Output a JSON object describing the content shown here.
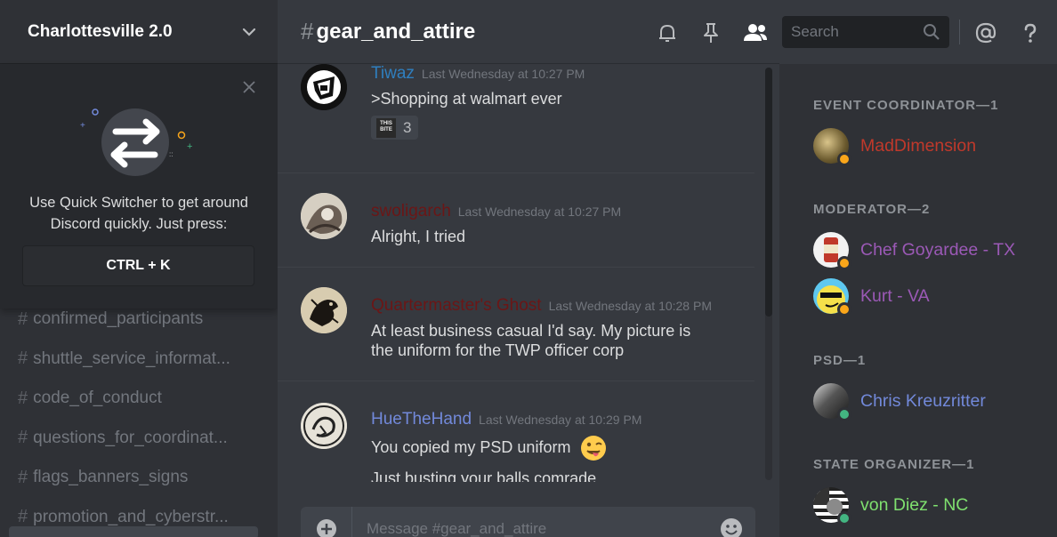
{
  "server": {
    "name": "Charlottesville 2.0"
  },
  "quick_switcher": {
    "line1": "Use Quick Switcher to get around",
    "line2": "Discord quickly. Just press:",
    "shortcut": "CTRL + K"
  },
  "channels": [
    {
      "name": "confirmed_participants"
    },
    {
      "name": "shuttle_service_informat..."
    },
    {
      "name": "code_of_conduct"
    },
    {
      "name": "questions_for_coordinat..."
    },
    {
      "name": "flags_banners_signs"
    },
    {
      "name": "promotion_and_cyberstr..."
    }
  ],
  "channel_header": {
    "hash": "#",
    "name": "gear_and_attire"
  },
  "search": {
    "placeholder": "Search"
  },
  "messages": [
    {
      "author": "Tiwaz",
      "author_color": "#2f7fbf",
      "timestamp": "Last Wednesday at 10:27 PM",
      "lines": [
        ">Shopping at walmart ever"
      ],
      "reaction": {
        "emoji_text": "THIS BITE",
        "count": "3"
      }
    },
    {
      "author": "swoligarch",
      "author_color": "#6b1616",
      "timestamp": "Last Wednesday at 10:27 PM",
      "lines": [
        "Alright, I tried"
      ]
    },
    {
      "author": "Quartermaster's Ghost",
      "author_color": "#6b1616",
      "timestamp": "Last Wednesday at 10:28 PM",
      "lines": [
        "At least business casual I'd say. My picture is",
        "the uniform for the TWP officer corp"
      ]
    },
    {
      "author": "HueTheHand",
      "author_color": "#7289da",
      "timestamp": "Last Wednesday at 10:29 PM",
      "lines": [
        "You copied my PSD uniform",
        "Just busting your balls comrade"
      ]
    }
  ],
  "composer": {
    "placeholder": "Message #gear_and_attire"
  },
  "member_groups": [
    {
      "role": "EVENT COORDINATOR—1",
      "members": [
        {
          "name": "MadDimension",
          "color": "#c0392b",
          "status": "idle"
        }
      ]
    },
    {
      "role": "MODERATOR—2",
      "members": [
        {
          "name": "Chef Goyardee - TX",
          "color": "#9b59b6",
          "status": "idle"
        },
        {
          "name": "Kurt - VA",
          "color": "#9b59b6",
          "status": "idle"
        }
      ]
    },
    {
      "role": "PSD—1",
      "members": [
        {
          "name": "Chris Kreuzritter",
          "color": "#7289da",
          "status": "online"
        }
      ]
    },
    {
      "role": "STATE ORGANIZER—1",
      "members": [
        {
          "name": "von Diez - NC",
          "color": "#7fe06f",
          "status": "online"
        }
      ]
    }
  ],
  "colors": {
    "accent": "#7289da",
    "idle": "#faa61a",
    "online": "#43b581"
  },
  "icons": [
    "chevron-down-icon",
    "close-icon",
    "switch-arrows-icon",
    "bell-icon",
    "pin-icon",
    "members-icon",
    "search-icon",
    "mention-icon",
    "help-icon",
    "add-icon",
    "emoji-icon"
  ]
}
